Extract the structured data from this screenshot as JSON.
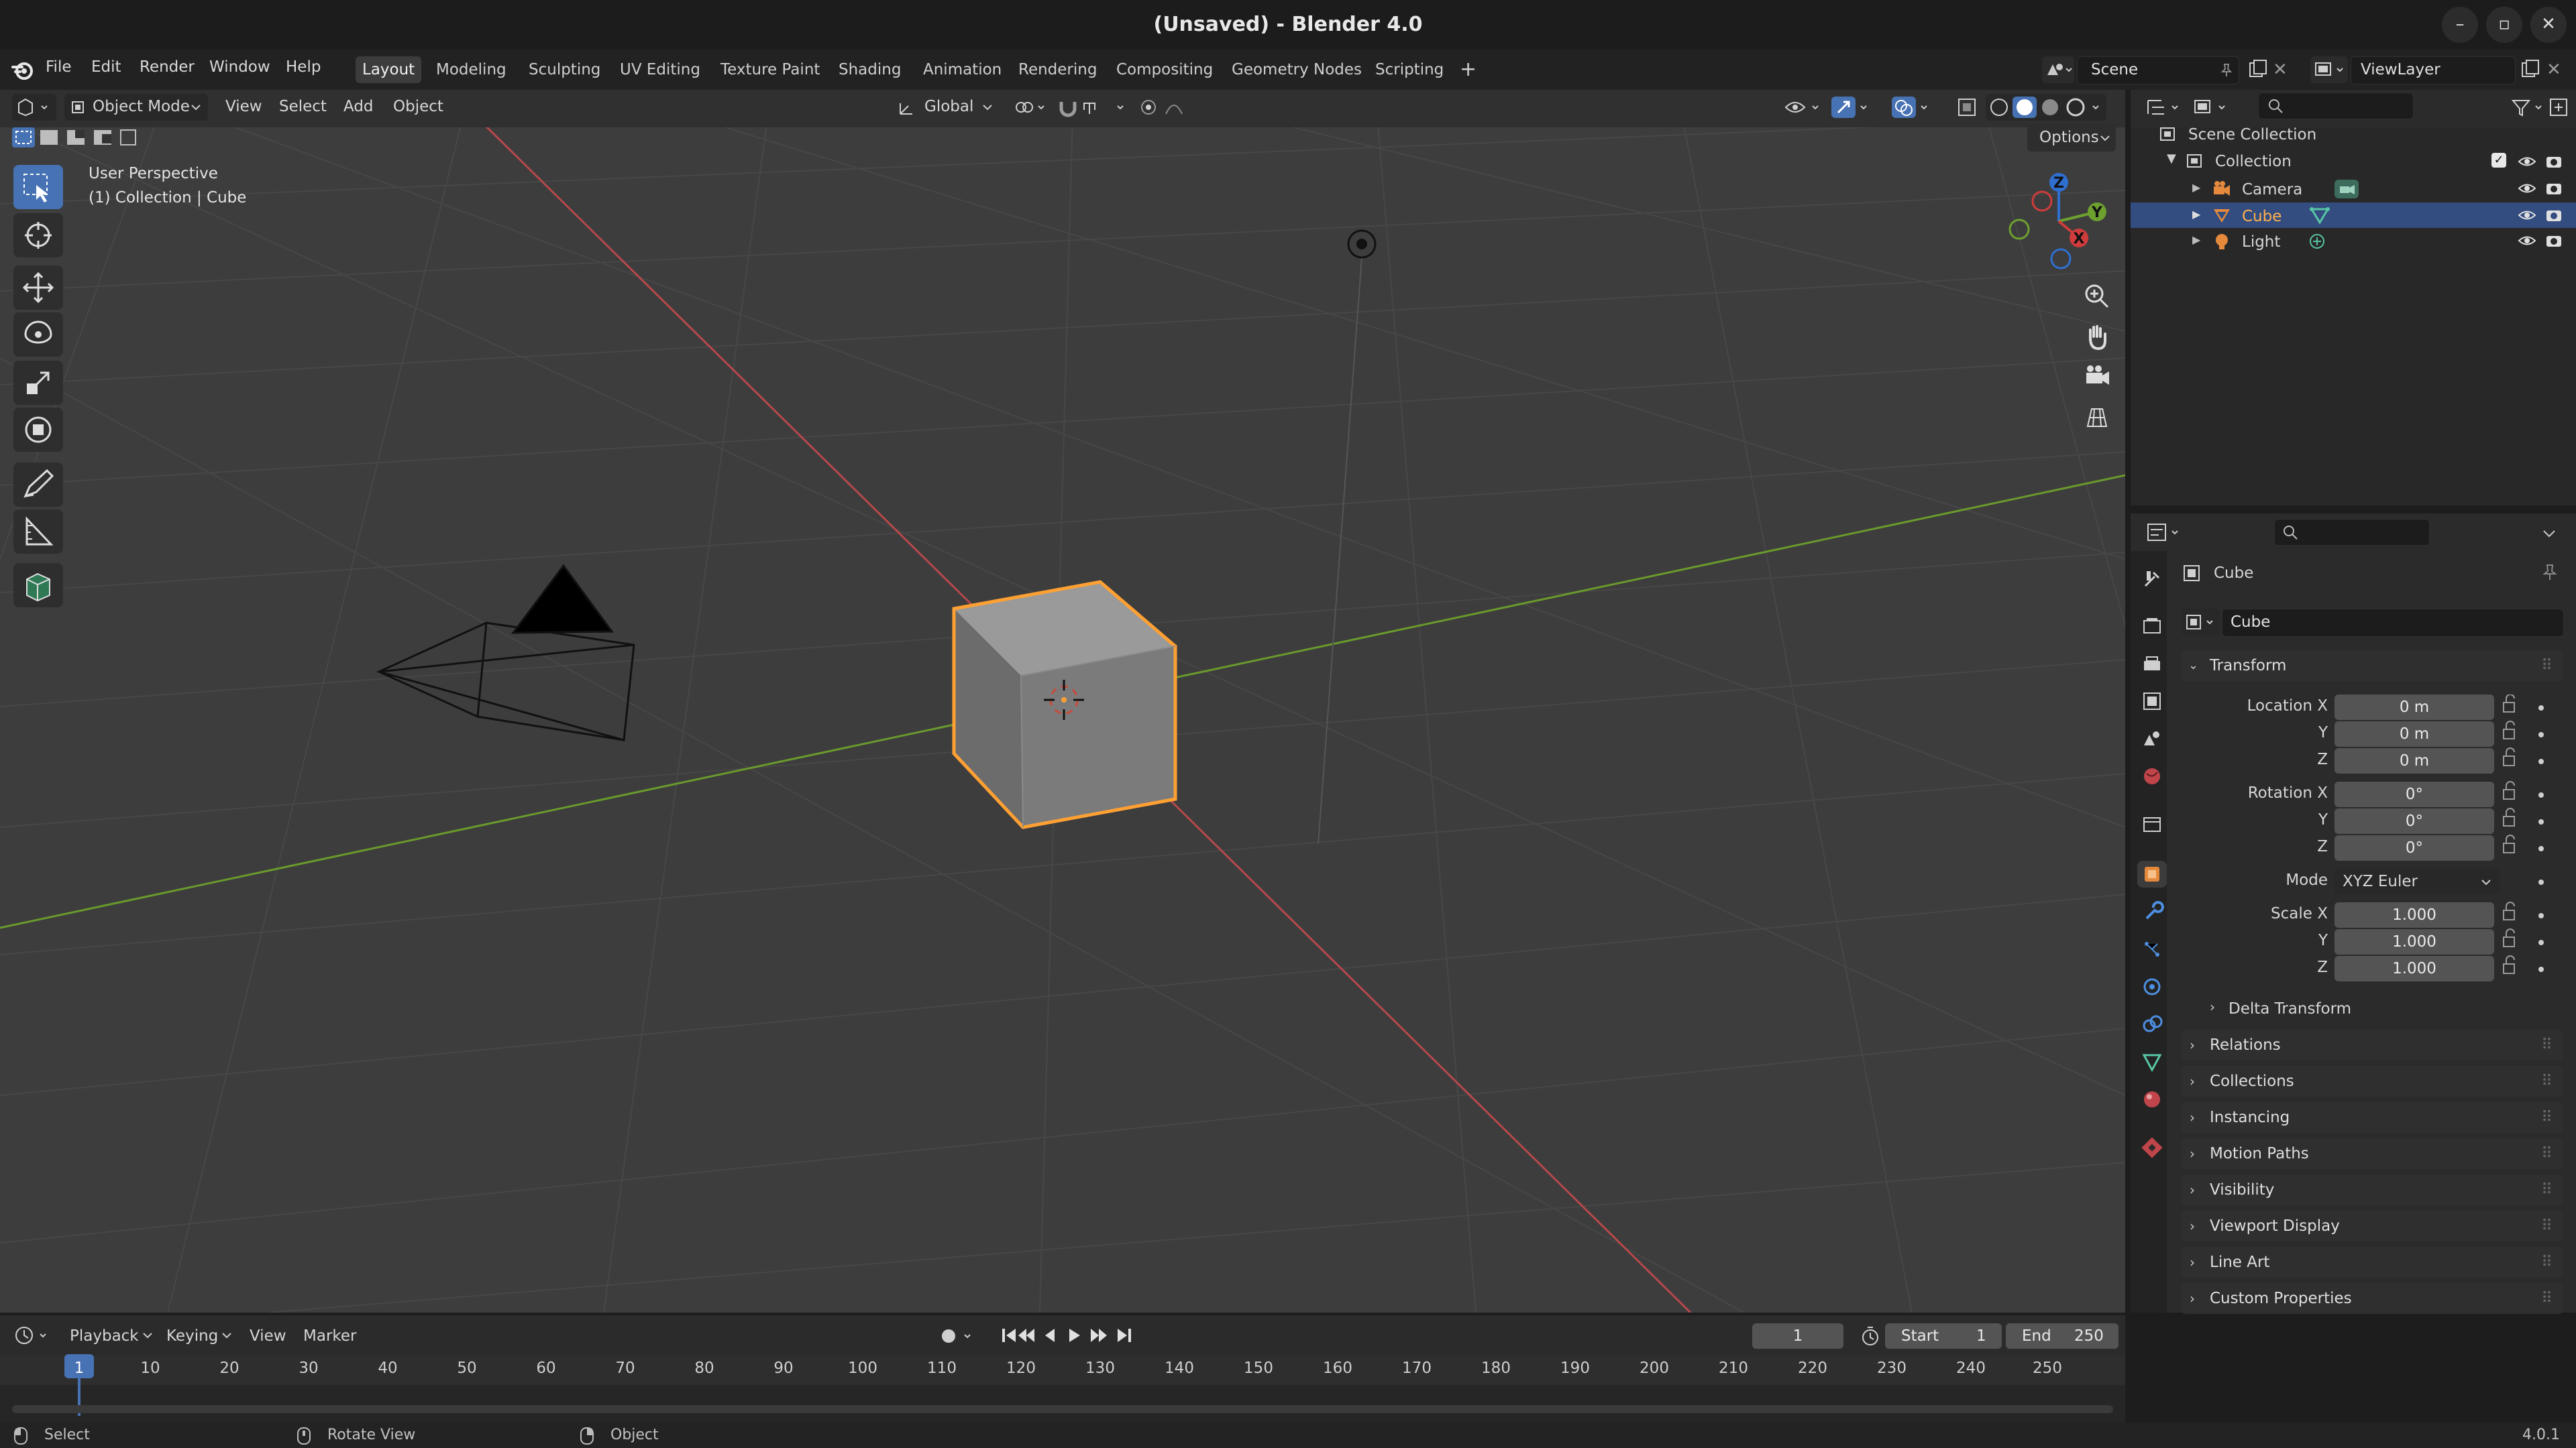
{
  "window": {
    "title": "(Unsaved) - Blender 4.0",
    "minimize": "–",
    "maximize": "▫",
    "close": "✕"
  },
  "menus": [
    "File",
    "Edit",
    "Render",
    "Window",
    "Help"
  ],
  "workspaces": [
    "Layout",
    "Modeling",
    "Sculpting",
    "UV Editing",
    "Texture Paint",
    "Shading",
    "Animation",
    "Rendering",
    "Compositing",
    "Geometry Nodes",
    "Scripting"
  ],
  "workspace_add": "+",
  "scene": {
    "name": "Scene"
  },
  "view_layer": {
    "name": "ViewLayer"
  },
  "viewport": {
    "mode": "Object Mode",
    "menus": [
      "View",
      "Select",
      "Add",
      "Object"
    ],
    "transform_orientation": "Global",
    "options_label": "Options",
    "overlay_line1": "User Perspective",
    "overlay_line2": "(1) Collection | Cube",
    "gizmo": {
      "x": "X",
      "y": "Y",
      "z": "Z"
    }
  },
  "outliner": {
    "scene_collection": "Scene Collection",
    "collection": "Collection",
    "items": [
      {
        "label": "Camera",
        "selected": false
      },
      {
        "label": "Cube",
        "selected": true
      },
      {
        "label": "Light",
        "selected": false
      }
    ]
  },
  "properties": {
    "object_name": "Cube",
    "data_name": "Cube",
    "transform": {
      "title": "Transform",
      "location_label": "Location X",
      "rotation_label": "Rotation X",
      "scale_label": "Scale X",
      "y_label": "Y",
      "z_label": "Z",
      "location": [
        "0 m",
        "0 m",
        "0 m"
      ],
      "rotation": [
        "0°",
        "0°",
        "0°"
      ],
      "mode_label": "Mode",
      "mode_value": "XYZ Euler",
      "scale": [
        "1.000",
        "1.000",
        "1.000"
      ]
    },
    "delta_transform": "Delta Transform",
    "panels": [
      "Relations",
      "Collections",
      "Instancing",
      "Motion Paths",
      "Visibility",
      "Viewport Display",
      "Line Art",
      "Custom Properties"
    ]
  },
  "timeline": {
    "menus": [
      "Playback",
      "Keying",
      "View",
      "Marker"
    ],
    "current_frame": "1",
    "start_label": "Start",
    "start_value": "1",
    "end_label": "End",
    "end_value": "250",
    "ruler": [
      "1",
      "10",
      "20",
      "30",
      "40",
      "50",
      "60",
      "70",
      "80",
      "90",
      "100",
      "110",
      "120",
      "130",
      "140",
      "150",
      "160",
      "170",
      "180",
      "190",
      "200",
      "210",
      "220",
      "230",
      "240",
      "250"
    ]
  },
  "status_bar": {
    "select": "Select",
    "rotate": "Rotate View",
    "object": "Object",
    "version": "4.0.1"
  },
  "colors": {
    "accent": "#4772b3",
    "selection_outline": "#ffa033",
    "x_axis": "#c04848",
    "y_axis": "#6b9a2c",
    "viewport_bg": "#3d3d3d"
  }
}
